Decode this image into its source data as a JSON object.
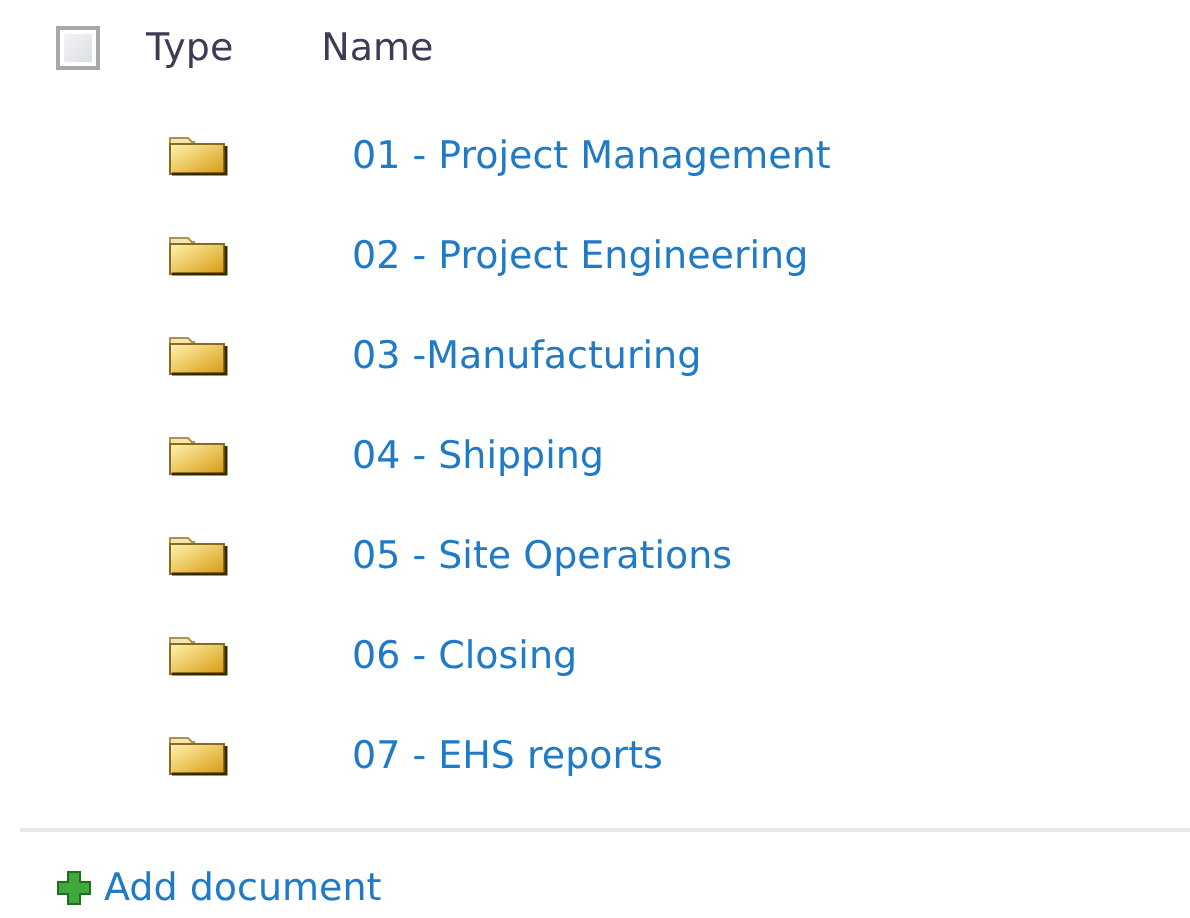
{
  "table": {
    "select_all": {
      "checked": false
    },
    "columns": [
      "Type",
      "Name"
    ],
    "rows": [
      {
        "name": "01 - Project Management"
      },
      {
        "name": "02 - Project Engineering"
      },
      {
        "name": "03 -Manufacturing"
      },
      {
        "name": "04 - Shipping"
      },
      {
        "name": "05 - Site Operations"
      },
      {
        "name": "06 - Closing"
      },
      {
        "name": "07 - EHS reports"
      }
    ]
  },
  "add_link": "Add document"
}
